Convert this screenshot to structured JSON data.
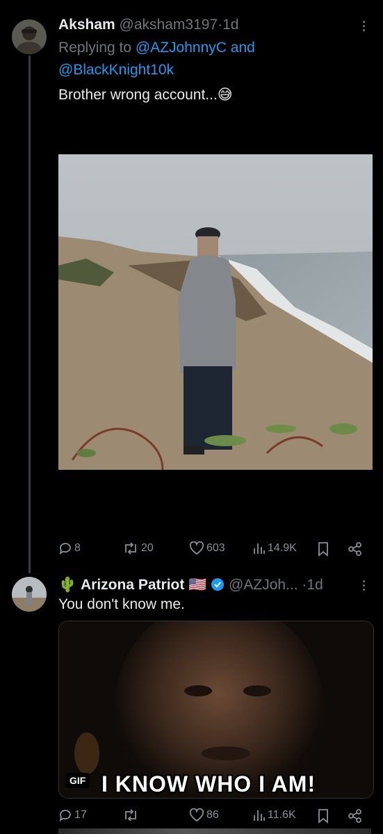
{
  "tweet1": {
    "display_name": "Aksham",
    "handle": "@aksham3197",
    "separator": "·",
    "time": "1d",
    "replying_prefix": "Replying to",
    "replying_to_1": "@AZJohnnyC",
    "replying_and": "and",
    "replying_to_2": "@BlackKnight10k",
    "text": "Brother wrong account...😅",
    "stats": {
      "replies": "8",
      "retweets": "20",
      "likes": "603",
      "views": "14.9K"
    }
  },
  "tweet2": {
    "name_emoji": "🌵",
    "display_name": "Arizona Patriot",
    "flag": "🇺🇸",
    "handle": "@AZJoh...",
    "separator": "·",
    "time": "1d",
    "text": "You don't know me.",
    "gif_badge": "GIF",
    "gif_caption": "I KNOW WHO I AM!",
    "stats": {
      "replies": "17",
      "retweets": "",
      "likes": "86",
      "views": "11.6K"
    }
  },
  "icons": [
    "more-icon",
    "reply-icon",
    "retweet-icon",
    "like-icon",
    "views-icon",
    "bookmark-icon",
    "share-icon",
    "verified-badge-icon"
  ],
  "colors": {
    "background": "#000000",
    "text": "#e7e9ea",
    "muted": "#71767b",
    "link": "#1d9bf0",
    "verified": "#1d9bf0"
  }
}
